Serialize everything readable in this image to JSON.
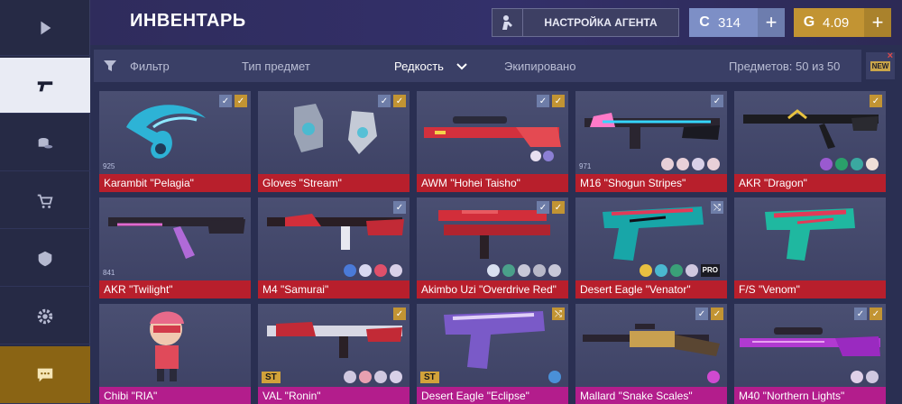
{
  "header": {
    "title": "ИНВЕНТАРЬ",
    "agent_button": "НАСТРОЙКА АГЕНТА",
    "currency_blue": {
      "icon": "C",
      "value": "314",
      "plus": "+"
    },
    "currency_gold": {
      "icon": "G",
      "value": "4.09",
      "plus": "+"
    }
  },
  "filters": {
    "filter": "Фильтр",
    "type": "Тип предмет",
    "rarity": "Редкость",
    "equipped": "Экипировано",
    "items_count": "Предметов: 50 из 50",
    "new_badge": "NEW"
  },
  "sidebar": {
    "items": [
      "play-icon",
      "pistol-icon",
      "cases-icon",
      "shop-icon",
      "clan-icon",
      "settings-icon",
      "chat-icon"
    ]
  },
  "items": [
    {
      "name": "Karambit \"Pelagia\"",
      "count": "925",
      "checks": [
        "blue",
        "gold"
      ],
      "rarity": "red"
    },
    {
      "name": "Gloves \"Stream\"",
      "checks": [
        "blue",
        "gold"
      ],
      "rarity": "red"
    },
    {
      "name": "AWM \"Hohei Taisho\"",
      "checks": [
        "blue",
        "gold"
      ],
      "rarity": "red"
    },
    {
      "name": "M16 \"Shogun Stripes\"",
      "count": "971",
      "checks": [
        "blue"
      ],
      "rarity": "red"
    },
    {
      "name": "AKR \"Dragon\"",
      "checks": [
        "gold"
      ],
      "rarity": "red"
    },
    {
      "name": "AKR \"Twilight\"",
      "count": "841",
      "checks": [],
      "rarity": "red"
    },
    {
      "name": "M4 \"Samurai\"",
      "checks": [
        "blue"
      ],
      "rarity": "red"
    },
    {
      "name": "Akimbo Uzi \"Overdrive Red\"",
      "checks": [
        "blue",
        "gold"
      ],
      "rarity": "red"
    },
    {
      "name": "Desert Eagle \"Venator\"",
      "checks": [
        "blue"
      ],
      "rarity": "red",
      "sticker_text": "PRO"
    },
    {
      "name": "F/S \"Venom\"",
      "checks": [],
      "rarity": "red"
    },
    {
      "name": "Chibi \"RIA\"",
      "checks": [],
      "rarity": "purple"
    },
    {
      "name": "VAL \"Ronin\"",
      "checks": [
        "gold"
      ],
      "rarity": "purple",
      "badge": "ST"
    },
    {
      "name": "Desert Eagle \"Eclipse\"",
      "checks": [
        "gold"
      ],
      "rarity": "purple",
      "badge": "ST"
    },
    {
      "name": "Mallard \"Snake Scales\"",
      "checks": [
        "blue",
        "gold"
      ],
      "rarity": "purple"
    },
    {
      "name": "M40 \"Northern Lights\"",
      "checks": [
        "blue",
        "gold"
      ],
      "rarity": "purple"
    }
  ],
  "colors": {
    "red_rarity": "#b81f2c",
    "purple_rarity": "#b31d8c",
    "gold": "#c29433",
    "blue_currency": "#7d8fc6"
  }
}
